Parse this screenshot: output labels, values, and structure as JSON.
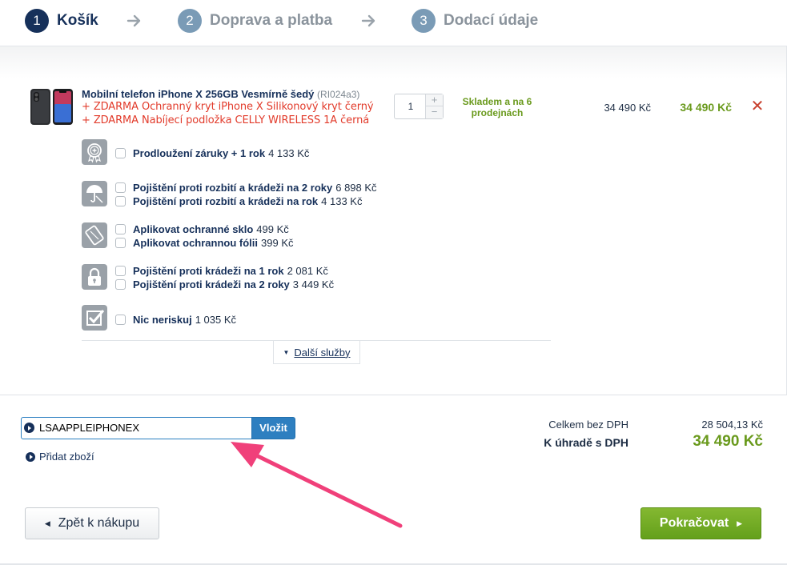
{
  "steps": [
    {
      "num": "1",
      "label": "Košík",
      "active": true
    },
    {
      "num": "2",
      "label": "Doprava a platba",
      "active": false
    },
    {
      "num": "3",
      "label": "Dodací údaje",
      "active": false
    }
  ],
  "product": {
    "name": "Mobilní telefon iPhone X 256GB Vesmírně šedý",
    "code": "(RI024a3)",
    "gifts": [
      "+ ZDARMA Ochranný kryt iPhone X Silikonový kryt černý",
      "+ ZDARMA Nabíjecí podložka CELLY WIRELESS 1A černá"
    ],
    "quantity": "1",
    "stock": "Skladem a na 6 prodejnách",
    "unit_price": "34 490 Kč",
    "total_price": "34 490 Kč"
  },
  "services": [
    {
      "icon": "warranty-icon",
      "options": [
        {
          "name": "Prodloužení záruky + 1 rok",
          "price": "4 133 Kč"
        }
      ]
    },
    {
      "icon": "umbrella-insurance-icon",
      "options": [
        {
          "name": "Pojištění proti rozbití a krádeži na 2 roky",
          "price": "6 898 Kč"
        },
        {
          "name": "Pojištění proti rozbití a krádeži na rok",
          "price": "4 133 Kč"
        }
      ]
    },
    {
      "icon": "screen-protector-icon",
      "options": [
        {
          "name": "Aplikovat ochranné sklo",
          "price": "499 Kč"
        },
        {
          "name": "Aplikovat ochrannou fólii",
          "price": "399 Kč"
        }
      ]
    },
    {
      "icon": "lock-icon",
      "options": [
        {
          "name": "Pojištění proti krádeži na 1 rok",
          "price": "2 081 Kč"
        },
        {
          "name": "Pojištění proti krádeži na 2 roky",
          "price": "3 449 Kč"
        }
      ]
    },
    {
      "icon": "checkmark-icon",
      "options": [
        {
          "name": "Nic neriskuj",
          "price": "1 035 Kč"
        }
      ]
    }
  ],
  "more_services_label": "Další služby",
  "coupon": {
    "value": "LSAAPPLEIPHONEX",
    "button_label": "Vložit"
  },
  "add_product_label": "Přidat zboží",
  "summary": {
    "without_vat_label": "Celkem bez DPH",
    "without_vat_value": "28 504,13 Kč",
    "with_vat_label": "K úhradě s DPH",
    "with_vat_value": "34 490 Kč"
  },
  "back_button_label": "Zpět k nákupu",
  "continue_button_label": "Pokračovat",
  "colors": {
    "primary": "#16305a",
    "green": "#6a9a1d",
    "red": "#e23b2b",
    "annotation_arrow": "#f0407a"
  }
}
